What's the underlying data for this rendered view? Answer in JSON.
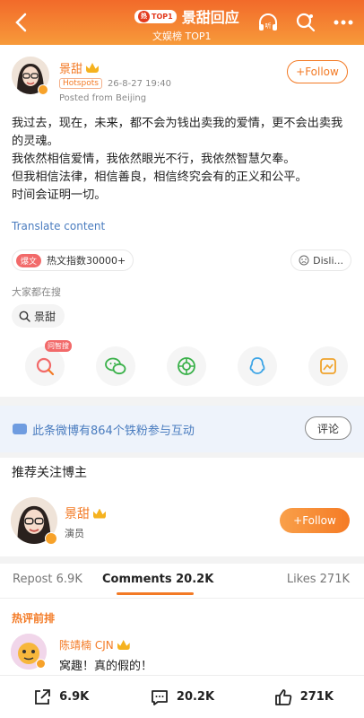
{
  "header": {
    "top1_badge": "TOP1",
    "top1_badge_icon": "热",
    "title": "景甜回应",
    "subtitle": "文娱榜 TOP1",
    "listen_label": "听"
  },
  "post": {
    "author": "景甜",
    "hotspots_tag": "Hotspots",
    "timestamp": "26-8-27 19:40",
    "location": "Posted from Beijing",
    "follow_label": "+Follow",
    "content_lines": [
      "我过去，现在，未来，都不会为钱出卖我的爱情，更不会出卖我的灵魂。",
      "我依然相信爱情，我依然眼光不行，我依然智慧欠奉。",
      "但我相信法律，相信善良，相信终究会有的正义和公平。",
      "时间会证明一切。"
    ],
    "translate_label": "Translate content",
    "hot_badge": "爆文",
    "hot_index": "热文指数30000+",
    "dislike_label": "Disli..."
  },
  "search": {
    "label": "大家都在搜",
    "query": "景甜"
  },
  "share": {
    "ask_badge": "问智搜"
  },
  "interaction": {
    "text": "此条微博有864个铁粉参与互动",
    "comment_button": "评论"
  },
  "recommend": {
    "title": "推荐关注博主",
    "name": "景甜",
    "desc": "演员",
    "follow_label": "+Follow"
  },
  "tabs": {
    "repost": "Repost 6.9K",
    "comments": "Comments 20.2K",
    "likes": "Likes 271K"
  },
  "comments": {
    "section_title": "热评前排",
    "items": [
      {
        "user": "陈靖楠 CJN",
        "text": "窝趣！真的假的！"
      }
    ]
  },
  "bottom_bar": {
    "repost_count": "6.9K",
    "comment_count": "20.2K",
    "like_count": "271K"
  },
  "colors": {
    "accent": "#f37a25",
    "header_gradient_top": "#f26a2a",
    "link_blue": "#4a7cbf"
  }
}
